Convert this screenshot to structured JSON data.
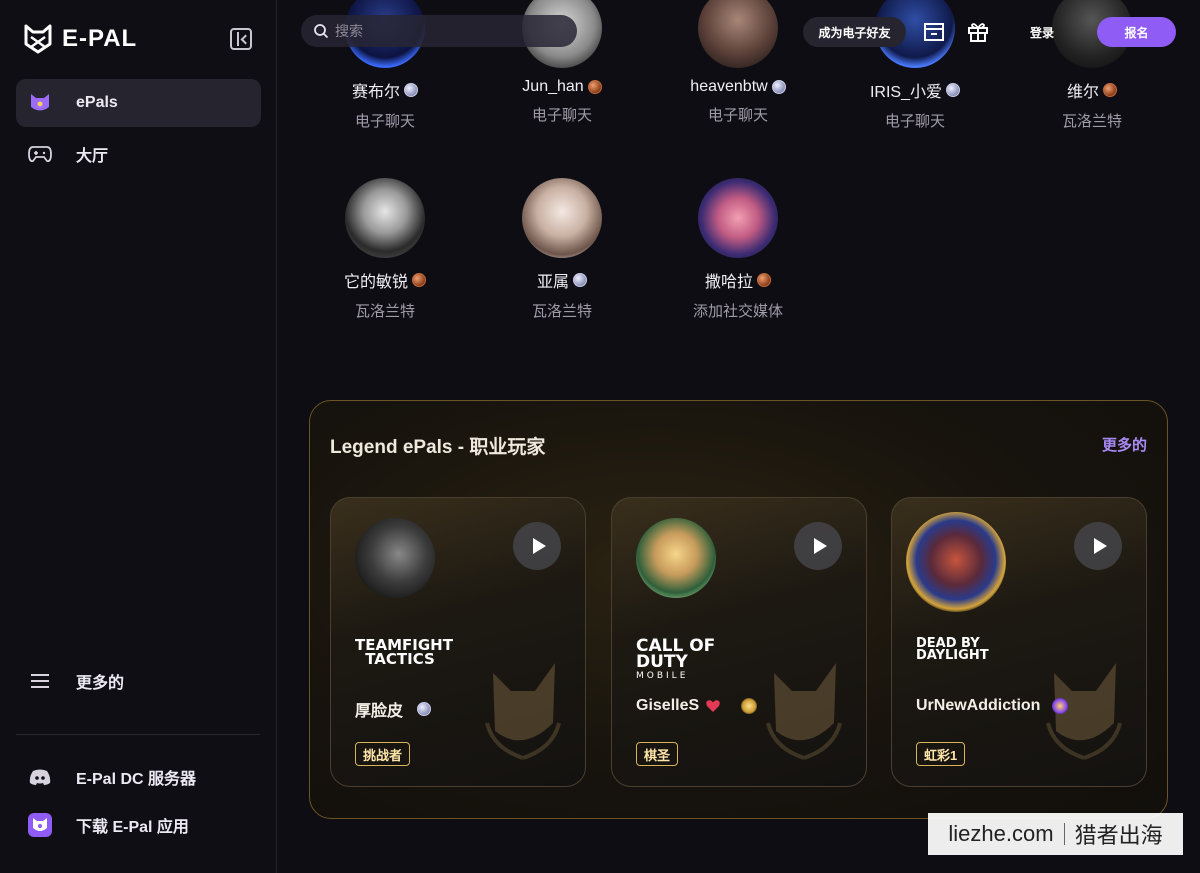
{
  "brand": {
    "name": "E-PAL"
  },
  "sidebar": {
    "items": [
      {
        "label": "ePals"
      },
      {
        "label": "大厅"
      },
      {
        "label": "更多的"
      },
      {
        "label": "E-Pal DC 服务器"
      },
      {
        "label": "下载 E-Pal 应用"
      }
    ]
  },
  "header": {
    "search_placeholder": "搜索",
    "become_label": "成为电子好友",
    "login_label": "登录",
    "signup_label": "报名"
  },
  "players": [
    {
      "name": "赛布尔",
      "sub": "电子聊天",
      "badge": "silver"
    },
    {
      "name": "Jun_han",
      "sub": "电子聊天",
      "badge": "bronze"
    },
    {
      "name": "heavenbtw",
      "sub": "电子聊天",
      "badge": "silver"
    },
    {
      "name": "IRIS_小爱",
      "sub": "电子聊天",
      "badge": "silver"
    },
    {
      "name": "维尔",
      "sub": "瓦洛兰特",
      "badge": "bronze"
    },
    {
      "name": "它的敏锐",
      "sub": "瓦洛兰特",
      "badge": "bronze"
    },
    {
      "name": "亚属",
      "sub": "瓦洛兰特",
      "badge": "silver"
    },
    {
      "name": "撒哈拉",
      "sub": "添加社交媒体",
      "badge": "bronze"
    }
  ],
  "legend": {
    "title": "Legend ePals - 职业玩家",
    "more_label": "更多的",
    "cards": [
      {
        "game": [
          "TEAMFIGHT",
          "TACTICS"
        ],
        "name": "厚脸皮",
        "tier": "挑战者"
      },
      {
        "game": [
          "CALL OF DUTY",
          "MOBILE"
        ],
        "name": "GiselleS",
        "tier": "棋圣"
      },
      {
        "game": [
          "DEAD BY",
          "DAYLIGHT"
        ],
        "name": "UrNewAddiction",
        "tier": "虹彩1"
      }
    ]
  },
  "watermark": {
    "left": "liezhe.com",
    "right": "猎者出海"
  }
}
